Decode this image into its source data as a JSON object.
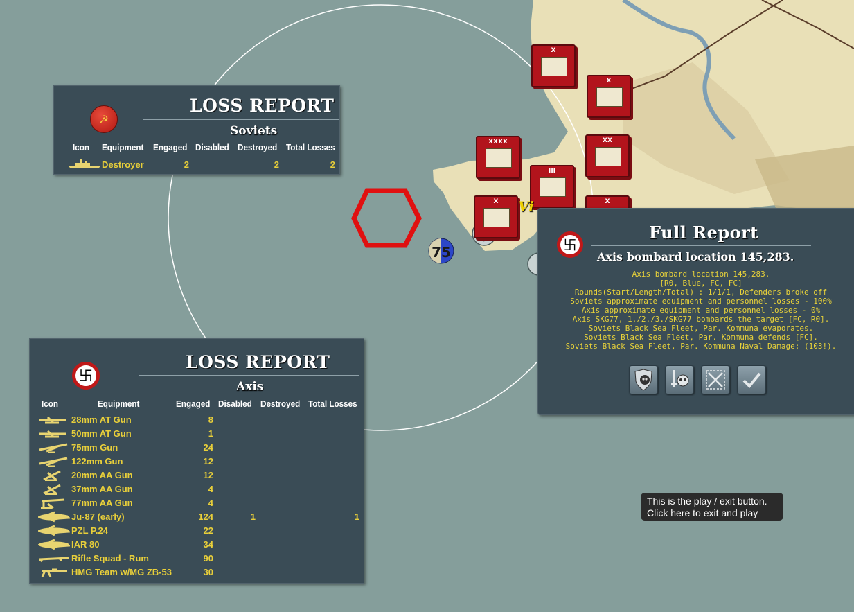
{
  "map": {
    "unit_badge_value": "75",
    "city_label": "Vi",
    "colors": {
      "sea": "#859e9b",
      "land": "#e9e0b7",
      "counter": "#b2141c",
      "hex_cursor": "#e01010"
    },
    "counters": [
      {
        "label": "X"
      },
      {
        "label": "X"
      },
      {
        "label": "XXXX"
      },
      {
        "label": "XX"
      },
      {
        "label": "III"
      },
      {
        "label": "X"
      },
      {
        "label": "X"
      }
    ]
  },
  "soviet_report": {
    "title": "LOSS REPORT",
    "side": "Soviets",
    "columns": [
      "Icon",
      "Equipment",
      "Engaged",
      "Disabled",
      "Destroyed",
      "Total Losses"
    ],
    "rows": [
      {
        "icon": "destroyer-ship-icon",
        "equipment": "Destroyer",
        "engaged": "2",
        "disabled": "",
        "destroyed": "2",
        "total": "2"
      }
    ]
  },
  "axis_report": {
    "title": "LOSS REPORT",
    "side": "Axis",
    "columns": [
      "Icon",
      "Equipment",
      "Engaged",
      "Disabled",
      "Destroyed",
      "Total Losses"
    ],
    "rows": [
      {
        "icon": "at-gun-icon",
        "equipment": "28mm AT Gun",
        "engaged": "8",
        "disabled": "",
        "destroyed": "",
        "total": ""
      },
      {
        "icon": "at-gun-icon",
        "equipment": "50mm AT Gun",
        "engaged": "1",
        "disabled": "",
        "destroyed": "",
        "total": ""
      },
      {
        "icon": "field-gun-icon",
        "equipment": "75mm Gun",
        "engaged": "24",
        "disabled": "",
        "destroyed": "",
        "total": ""
      },
      {
        "icon": "field-gun-icon",
        "equipment": "122mm Gun",
        "engaged": "12",
        "disabled": "",
        "destroyed": "",
        "total": ""
      },
      {
        "icon": "aa-gun-icon",
        "equipment": "20mm AA Gun",
        "engaged": "12",
        "disabled": "",
        "destroyed": "",
        "total": ""
      },
      {
        "icon": "aa-gun-icon",
        "equipment": "37mm AA Gun",
        "engaged": "4",
        "disabled": "",
        "destroyed": "",
        "total": ""
      },
      {
        "icon": "heavy-aa-gun-icon",
        "equipment": "77mm AA Gun",
        "engaged": "4",
        "disabled": "",
        "destroyed": "",
        "total": ""
      },
      {
        "icon": "aircraft-icon",
        "equipment": "Ju-87 (early)",
        "engaged": "124",
        "disabled": "1",
        "destroyed": "",
        "total": "1"
      },
      {
        "icon": "aircraft-icon",
        "equipment": "PZL P.24",
        "engaged": "22",
        "disabled": "",
        "destroyed": "",
        "total": ""
      },
      {
        "icon": "aircraft-icon",
        "equipment": "IAR 80",
        "engaged": "34",
        "disabled": "",
        "destroyed": "",
        "total": ""
      },
      {
        "icon": "rifle-icon",
        "equipment": "Rifle Squad - Rum",
        "engaged": "90",
        "disabled": "",
        "destroyed": "",
        "total": ""
      },
      {
        "icon": "machine-gun-icon",
        "equipment": "HMG Team w/MG ZB-53",
        "engaged": "30",
        "disabled": "",
        "destroyed": "",
        "total": ""
      }
    ]
  },
  "full_report": {
    "title": "Full Report",
    "subtitle": "Axis bombard location 145,283.",
    "lines": [
      "Axis bombard location 145,283.",
      "[R0, Blue, FC, FC]",
      "Rounds(Start/Length/Total) : 1/1/1, Defenders broke off",
      "Soviets approximate equipment and personnel losses - 100%",
      "Axis approximate equipment and personnel losses - 0%",
      "Axis SKG77, 1./2./3./SKG77 bombards the target [FC, R0].",
      "Soviets Black Sea Fleet, Par. Kommuna evaporates.",
      "Soviets Black Sea Fleet, Par. Kommuna defends [FC].",
      "Soviets Black Sea Fleet, Par. Kommuna Naval Damage: (103!)."
    ]
  },
  "tooltip": {
    "line1": "This is the play / exit button.",
    "line2": "Click here to exit and play"
  }
}
